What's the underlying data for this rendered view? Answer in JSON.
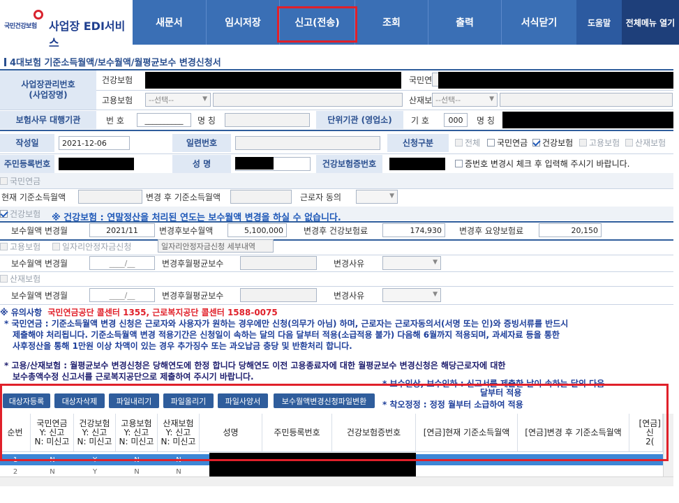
{
  "header": {
    "logo_text": "국민건강보험",
    "app_title": "사업장 EDI서비스",
    "menu": [
      "새문서",
      "임시저장",
      "신고(전송)",
      "조회",
      "출력",
      "서식닫기"
    ],
    "help": "도움말",
    "full_menu": "전체메뉴 열기"
  },
  "form_title": "4대보험 기준소득월액/보수월액/월평균보수 변경신청서",
  "biz": {
    "label": "사업장관리번호\n(사업장명)",
    "health": "건강보험",
    "employment": "고용보험",
    "pension": "국민연금",
    "industrial": "산재보험",
    "select_placeholder": "--선택--",
    "agent_label": "보험사무 대행기관",
    "number_label": "번 호",
    "number_value": "__________",
    "name_label": "명 칭",
    "unit_label": "단위기관 (영업소)",
    "code_label": "기 호",
    "code_value": "000",
    "unit_name_label": "명 칭"
  },
  "info": {
    "date_label": "작성일",
    "date_value": "2021-12-06",
    "serial_label": "일련번호",
    "type_label": "신청구분",
    "type_all": "전체",
    "type_pension": "국민연금",
    "type_health": "건강보험",
    "type_employment": "고용보험",
    "type_industrial": "산재보험",
    "rrn_label": "주민등록번호",
    "name_label": "성 명",
    "card_label": "건강보험증번호",
    "card_note": "증번호 변경시 체크 후 입력해 주시기 바랍니다."
  },
  "pension": {
    "title": "국민연금",
    "current_label": "현재 기준소득월액",
    "after_label": "변경 후 기준소득월액",
    "consent_label": "근로자 동의"
  },
  "health": {
    "title": "건강보험",
    "note": "※ 건강보험 : 연말정산을 처리된 연도는 보수월액 변경을 하실 수 없습니다.",
    "month_label": "보수월액 변경월",
    "month_value": "2021/11",
    "pay_label": "변경후보수월액",
    "pay_value": "5,100,000",
    "premium_label": "변경후 건강보험료",
    "premium_value": "174,930",
    "ltc_label": "변경후 요양보험료",
    "ltc_value": "20,150"
  },
  "employment": {
    "title": "고용보험",
    "subsidy_title": "일자리안정자금신청",
    "subsidy_detail": "일자리안정자금신청 세부내역",
    "month_label": "보수월액 변경월",
    "month_value": "____/__",
    "avg_label": "변경후월평균보수",
    "reason_label": "변경사유"
  },
  "industrial": {
    "title": "산재보험",
    "month_label": "보수월액 변경월",
    "month_value": "____/__",
    "avg_label": "변경후월평균보수",
    "reason_label": "변경사유"
  },
  "notices": {
    "line1_prefix": "※ 유의사항",
    "line1": "국민연금공단 콜센터 1355, 근로복지공단 콜센터 1588-0075",
    "line2": "* 국민연금 : 기준소득월액 변경 신청은 근로자와 사용자가 원하는 경우에만 신청(의무가 아님) 하며, 근로자는 근로자동의서(서명 또는 인)와 증빙서류를 반드시",
    "line3": "제출해야 처리됩니다. 기준소득월액 변경 적용기간은 신청일이 속하는 달의 다음 달부터 적용(소급적용 불가) 다음해 6월까지 적용되며, 과세자료 등을 통한",
    "line4": "사후정산을 통해 1만원 이상 차액이 있는 경우 추가징수 또는 과오납금 충당 및 반환처리 합니다.",
    "line5": "* 고용/산재보험 : 월평균보수 변경신청은 당해연도에 한정 합니다 당해연도 이전 고용종료자에 대한 월평균보수 변경신청은 해당근로자에 대한",
    "line6": "보수총액수정 신고서를 근로복지공단으로 제출하여 주시기 바랍니다.",
    "side1": "* 보수인상, 보수인하 : 신고서를 제출한 날이 속하는 달의 다음",
    "side2": "달부터 적용",
    "side3": "* 착오정정 : 정정 월부터 소급하여 적용"
  },
  "toolbar": [
    "대상자등록",
    "대상자삭제",
    "파일내리기",
    "파일올리기",
    "파일사양서",
    "보수월액변경신청파일변환"
  ],
  "table": {
    "headers": [
      "순번",
      "국민연금\nY: 신고\nN: 미신고",
      "건강보험\nY: 신고\nN: 미신고",
      "고용보험\nY: 신고\nN: 미신고",
      "산재보험\nY: 신고\nN: 미신고",
      "성명",
      "주민등록번호",
      "건강보험증번호",
      "[연금]현재 기준소득월액",
      "[연금]변경 후 기준소득월액",
      "[연금]\n신\n2("
    ],
    "rows": [
      [
        "1",
        "N",
        "Y",
        "N",
        "N"
      ],
      [
        "2",
        "N",
        "Y",
        "N",
        "N"
      ]
    ]
  },
  "colors": {
    "brand": "#3a6fb5",
    "highlight": "#e0202a",
    "selected_row": "#3d87d6"
  }
}
